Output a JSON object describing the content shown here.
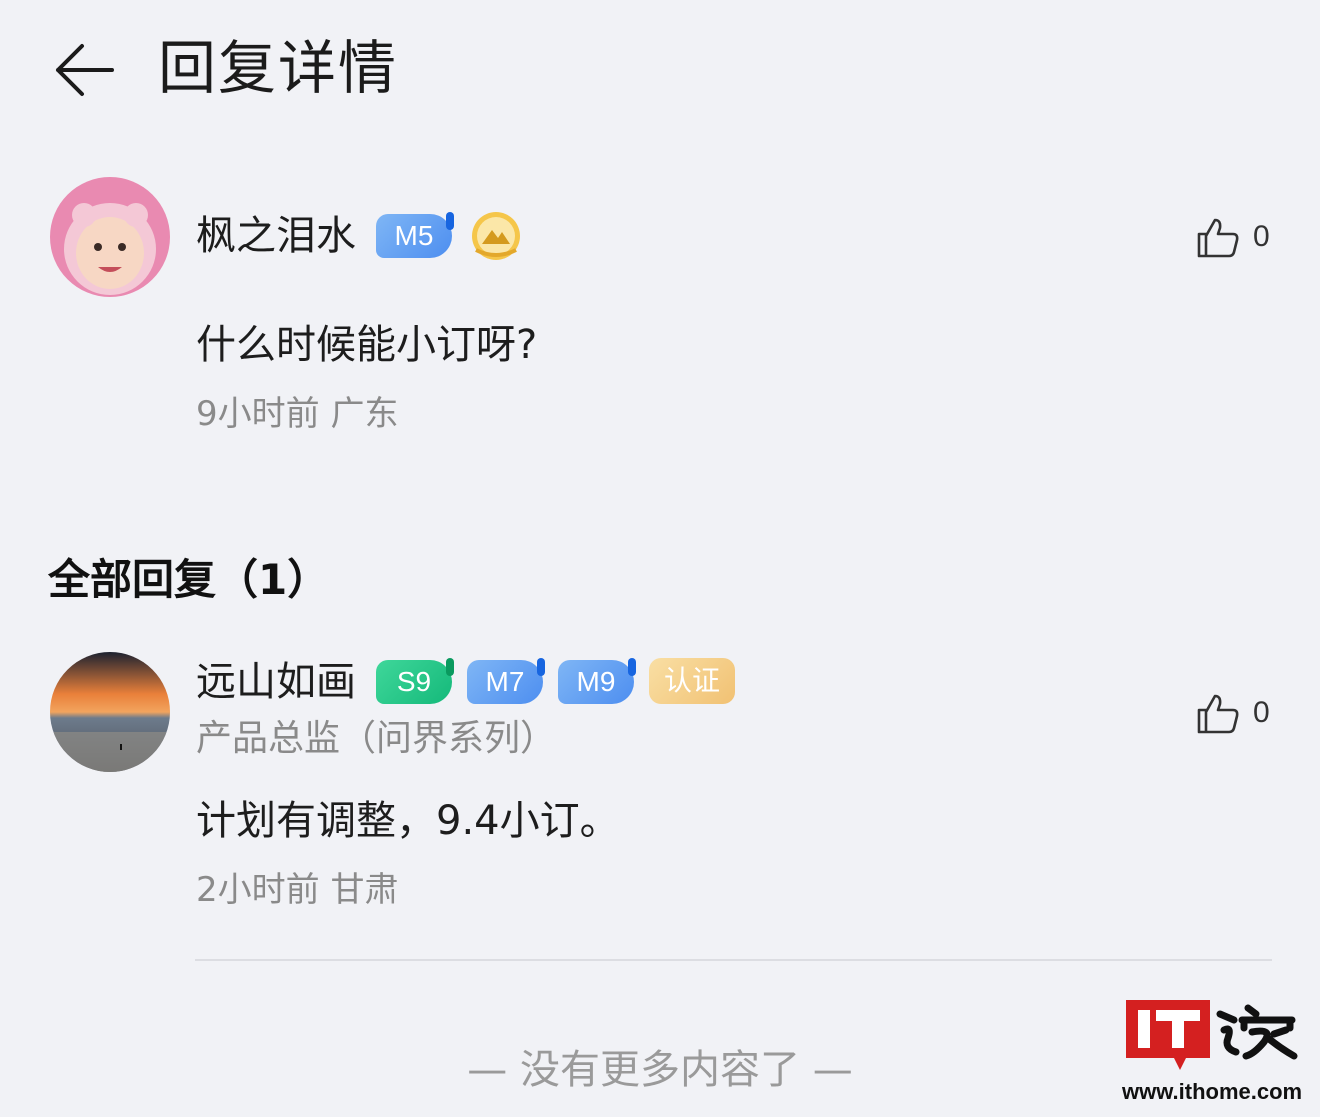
{
  "header": {
    "title": "回复详情",
    "back_icon": "arrow-left-icon"
  },
  "main_comment": {
    "username": "枫之泪水",
    "badges": [
      "M5"
    ],
    "medal_icon": "mountain-medal-icon",
    "text": "什么时候能小订呀?",
    "meta": "9小时前 广东",
    "like_count": "0"
  },
  "replies_section": {
    "title": "全部回复（1）"
  },
  "reply": {
    "username": "远山如画",
    "badges": [
      "S9",
      "M7",
      "M9",
      "认证"
    ],
    "role": "产品总监（问界系列）",
    "text": "计划有调整，9.4小订。",
    "meta": "2小时前 甘肃",
    "like_count": "0"
  },
  "footer": {
    "end_text": "— 没有更多内容了 —"
  },
  "watermark": {
    "logo_text": "IT之家",
    "url": "www.ithome.com"
  },
  "colors": {
    "background": "#f1f2f6",
    "badge_m": "#4d8ef0",
    "badge_s": "#14b97a",
    "badge_cert": "#f1c173",
    "meta_text": "#8a8a8a",
    "watermark_red": "#d42020"
  }
}
